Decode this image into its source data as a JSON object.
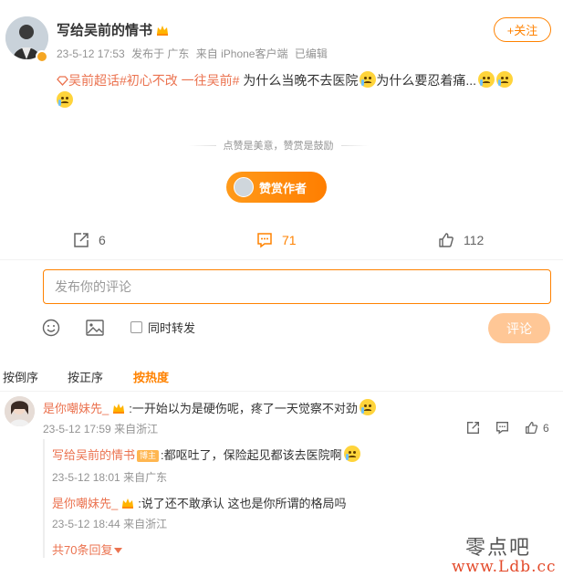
{
  "post": {
    "author": "写给吴前的情书",
    "time": "23-5-12 17:53",
    "location": "发布于 广东",
    "source": "来自 iPhone客户端",
    "edited": "已编辑",
    "follow_label": "+关注",
    "topic_tag": "吴前超话",
    "hashtag": "#初心不改 一往吴前#",
    "text": "为什么当晚不去医院",
    "text2": "为什么要忍着痛..."
  },
  "reward": {
    "tip": "点赞是美意，赞赏是鼓励",
    "button_label": "赞赏作者"
  },
  "stats": {
    "reposts": "6",
    "comments": "71",
    "likes": "112"
  },
  "composer": {
    "placeholder": "发布你的评论",
    "repost_label": "同时转发",
    "submit_label": "评论"
  },
  "sort": {
    "by_time_desc": "按倒序",
    "by_time_asc": "按正序",
    "by_hot": "按热度"
  },
  "comment": {
    "user": "是你嘲妹先_",
    "text": ":一开始以为是硬伤呢，疼了一天觉察不对劲",
    "time": "23-5-12 17:59",
    "location": "来自浙江",
    "likes": "6"
  },
  "replies": [
    {
      "user": "写给吴前的情书",
      "badge": "博主",
      "text": ":都呕吐了，保险起见都该去医院啊",
      "time": "23-5-12 18:01",
      "location": "来自广东"
    },
    {
      "user": "是你嘲妹先_",
      "text": ":说了还不敢承认 这也是你所谓的格局吗",
      "time": "23-5-12 18:44",
      "location": "来自浙江"
    }
  ],
  "more_replies": "共70条回复",
  "watermark": {
    "line1": "零点吧",
    "line2": "www.Ldb.cc"
  },
  "colors": {
    "accent": "#ff8200",
    "link": "#eb7350",
    "meta": "#939393"
  }
}
